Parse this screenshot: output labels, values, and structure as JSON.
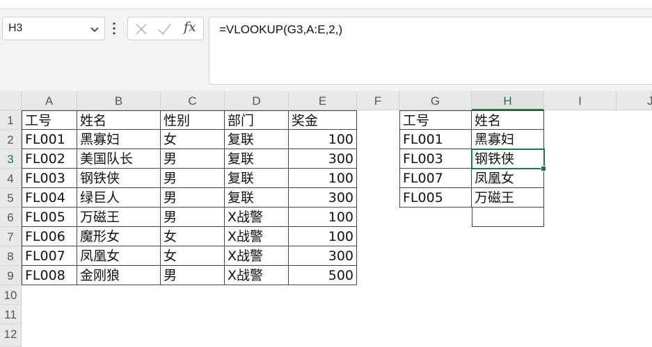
{
  "name_box": {
    "value": "H3"
  },
  "formula_bar": {
    "formula": "=VLOOKUP(G3,A:E,2,)"
  },
  "columns": [
    "A",
    "B",
    "C",
    "D",
    "E",
    "F",
    "G",
    "H",
    "I",
    "J"
  ],
  "active_column": "H",
  "rows": [
    "1",
    "2",
    "3",
    "4",
    "5",
    "6",
    "7",
    "8",
    "9",
    "10",
    "11",
    "12"
  ],
  "active_row": "3",
  "table1": {
    "header": [
      "工号",
      "姓名",
      "性别",
      "部门",
      "奖金"
    ],
    "rows": [
      [
        "FL001",
        "黑寡妇",
        "女",
        "复联",
        "100"
      ],
      [
        "FL002",
        "美国队长",
        "男",
        "复联",
        "300"
      ],
      [
        "FL003",
        "钢铁侠",
        "男",
        "复联",
        "100"
      ],
      [
        "FL004",
        "绿巨人",
        "男",
        "复联",
        "300"
      ],
      [
        "FL005",
        "万磁王",
        "男",
        "X战警",
        "100"
      ],
      [
        "FL006",
        "魔形女",
        "女",
        "X战警",
        "100"
      ],
      [
        "FL007",
        "凤凰女",
        "女",
        "X战警",
        "300"
      ],
      [
        "FL008",
        "金刚狼",
        "男",
        "X战警",
        "500"
      ]
    ]
  },
  "table2": {
    "header": [
      "工号",
      "姓名"
    ],
    "rows": [
      [
        "FL001",
        "黑寡妇"
      ],
      [
        "FL003",
        "钢铁侠"
      ],
      [
        "FL007",
        "凤凰女"
      ],
      [
        "FL005",
        "万磁王"
      ],
      [
        "",
        ""
      ]
    ]
  },
  "icons": {
    "name_box_dropdown": "chevron-down-icon",
    "more": "vertical-dots-icon",
    "cancel": "close-icon",
    "confirm": "check-icon",
    "function": "fx-icon"
  },
  "fx_label": "fx",
  "colors": {
    "accent": "#217346"
  }
}
